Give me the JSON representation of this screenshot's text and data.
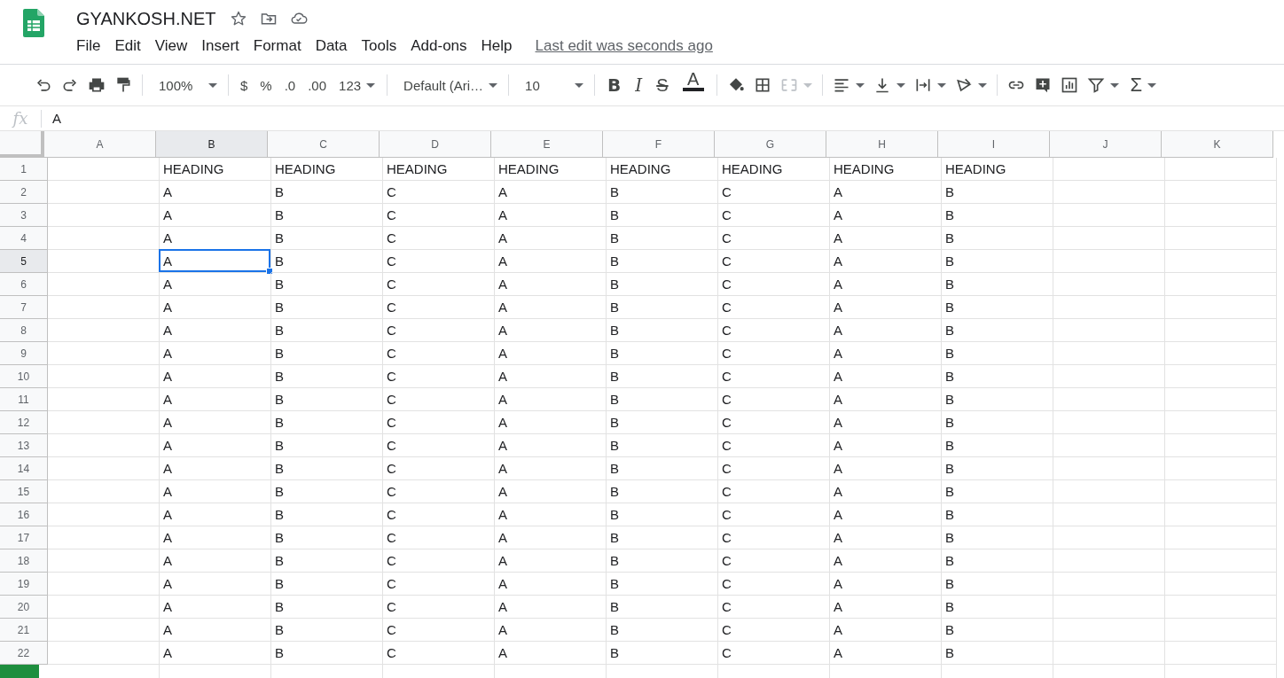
{
  "document": {
    "title": "GYANKOSH.NET",
    "last_edit": "Last edit was seconds ago"
  },
  "menu": [
    "File",
    "Edit",
    "View",
    "Insert",
    "Format",
    "Data",
    "Tools",
    "Add-ons",
    "Help"
  ],
  "toolbar": [
    [
      {
        "kind": "undo"
      },
      {
        "kind": "redo"
      },
      {
        "kind": "print"
      },
      {
        "kind": "paint-format"
      }
    ],
    [
      {
        "kind": "select",
        "text": "100%",
        "wide": false
      }
    ],
    [
      {
        "kind": "text",
        "text": "$"
      },
      {
        "kind": "text",
        "text": "%"
      },
      {
        "kind": "text",
        "text": ".0"
      },
      {
        "kind": "text",
        "text": ".00"
      },
      {
        "kind": "menu-text",
        "text": "123"
      }
    ],
    [
      {
        "kind": "select",
        "text": "Default (Ari…",
        "wide": true
      }
    ],
    [
      {
        "kind": "select",
        "text": "10",
        "wide": false
      }
    ],
    [
      {
        "kind": "bold",
        "text": "B"
      },
      {
        "kind": "italic",
        "text": "I"
      },
      {
        "kind": "strike",
        "text": "S"
      },
      {
        "kind": "text-color",
        "text": "A",
        "color": "#202124"
      }
    ],
    [
      {
        "kind": "fill"
      },
      {
        "kind": "borders"
      },
      {
        "kind": "merge",
        "disabled": true
      }
    ],
    [
      {
        "kind": "align"
      },
      {
        "kind": "valign"
      },
      {
        "kind": "wrap"
      },
      {
        "kind": "rotate"
      }
    ],
    [
      {
        "kind": "link"
      },
      {
        "kind": "comment"
      },
      {
        "kind": "chart"
      },
      {
        "kind": "filter"
      },
      {
        "kind": "functions",
        "text": "Σ"
      }
    ]
  ],
  "formula_bar": {
    "label": "fx",
    "value": "A"
  },
  "columns": [
    {
      "label": "A",
      "selected": false
    },
    {
      "label": "B",
      "selected": true
    },
    {
      "label": "C",
      "selected": false
    },
    {
      "label": "D",
      "selected": false
    },
    {
      "label": "E",
      "selected": false
    },
    {
      "label": "F",
      "selected": false
    },
    {
      "label": "G",
      "selected": false
    },
    {
      "label": "H",
      "selected": false
    },
    {
      "label": "I",
      "selected": false
    },
    {
      "label": "J",
      "selected": false
    },
    {
      "label": "K",
      "selected": false
    }
  ],
  "rows": [
    {
      "number": "1",
      "selected": false,
      "cells": [
        null,
        "HEADING",
        "HEADING",
        "HEADING",
        "HEADING",
        "HEADING",
        "HEADING",
        "HEADING",
        "HEADING",
        null,
        null
      ]
    },
    {
      "number": "2",
      "selected": false,
      "cells": [
        null,
        "A",
        "B",
        "C",
        "A",
        "B",
        "C",
        "A",
        "B",
        null,
        null
      ]
    },
    {
      "number": "3",
      "selected": false,
      "cells": [
        null,
        "A",
        "B",
        "C",
        "A",
        "B",
        "C",
        "A",
        "B",
        null,
        null
      ]
    },
    {
      "number": "4",
      "selected": false,
      "cells": [
        null,
        "A",
        "B",
        "C",
        "A",
        "B",
        "C",
        "A",
        "B",
        null,
        null
      ]
    },
    {
      "number": "5",
      "selected": true,
      "cells": [
        null,
        "A",
        "B",
        "C",
        "A",
        "B",
        "C",
        "A",
        "B",
        null,
        null
      ]
    },
    {
      "number": "6",
      "selected": false,
      "cells": [
        null,
        "A",
        "B",
        "C",
        "A",
        "B",
        "C",
        "A",
        "B",
        null,
        null
      ]
    },
    {
      "number": "7",
      "selected": false,
      "cells": [
        null,
        "A",
        "B",
        "C",
        "A",
        "B",
        "C",
        "A",
        "B",
        null,
        null
      ]
    },
    {
      "number": "8",
      "selected": false,
      "cells": [
        null,
        "A",
        "B",
        "C",
        "A",
        "B",
        "C",
        "A",
        "B",
        null,
        null
      ]
    },
    {
      "number": "9",
      "selected": false,
      "cells": [
        null,
        "A",
        "B",
        "C",
        "A",
        "B",
        "C",
        "A",
        "B",
        null,
        null
      ]
    },
    {
      "number": "10",
      "selected": false,
      "cells": [
        null,
        "A",
        "B",
        "C",
        "A",
        "B",
        "C",
        "A",
        "B",
        null,
        null
      ]
    },
    {
      "number": "11",
      "selected": false,
      "cells": [
        null,
        "A",
        "B",
        "C",
        "A",
        "B",
        "C",
        "A",
        "B",
        null,
        null
      ]
    },
    {
      "number": "12",
      "selected": false,
      "cells": [
        null,
        "A",
        "B",
        "C",
        "A",
        "B",
        "C",
        "A",
        "B",
        null,
        null
      ]
    },
    {
      "number": "13",
      "selected": false,
      "cells": [
        null,
        "A",
        "B",
        "C",
        "A",
        "B",
        "C",
        "A",
        "B",
        null,
        null
      ]
    },
    {
      "number": "14",
      "selected": false,
      "cells": [
        null,
        "A",
        "B",
        "C",
        "A",
        "B",
        "C",
        "A",
        "B",
        null,
        null
      ]
    },
    {
      "number": "15",
      "selected": false,
      "cells": [
        null,
        "A",
        "B",
        "C",
        "A",
        "B",
        "C",
        "A",
        "B",
        null,
        null
      ]
    },
    {
      "number": "16",
      "selected": false,
      "cells": [
        null,
        "A",
        "B",
        "C",
        "A",
        "B",
        "C",
        "A",
        "B",
        null,
        null
      ]
    },
    {
      "number": "17",
      "selected": false,
      "cells": [
        null,
        "A",
        "B",
        "C",
        "A",
        "B",
        "C",
        "A",
        "B",
        null,
        null
      ]
    },
    {
      "number": "18",
      "selected": false,
      "cells": [
        null,
        "A",
        "B",
        "C",
        "A",
        "B",
        "C",
        "A",
        "B",
        null,
        null
      ]
    },
    {
      "number": "19",
      "selected": false,
      "cells": [
        null,
        "A",
        "B",
        "C",
        "A",
        "B",
        "C",
        "A",
        "B",
        null,
        null
      ]
    },
    {
      "number": "20",
      "selected": false,
      "cells": [
        null,
        "A",
        "B",
        "C",
        "A",
        "B",
        "C",
        "A",
        "B",
        null,
        null
      ]
    },
    {
      "number": "21",
      "selected": false,
      "cells": [
        null,
        "A",
        "B",
        "C",
        "A",
        "B",
        "C",
        "A",
        "B",
        null,
        null
      ]
    },
    {
      "number": "22",
      "selected": false,
      "cells": [
        null,
        "A",
        "B",
        "C",
        "A",
        "B",
        "C",
        "A",
        "B",
        null,
        null
      ]
    }
  ]
}
